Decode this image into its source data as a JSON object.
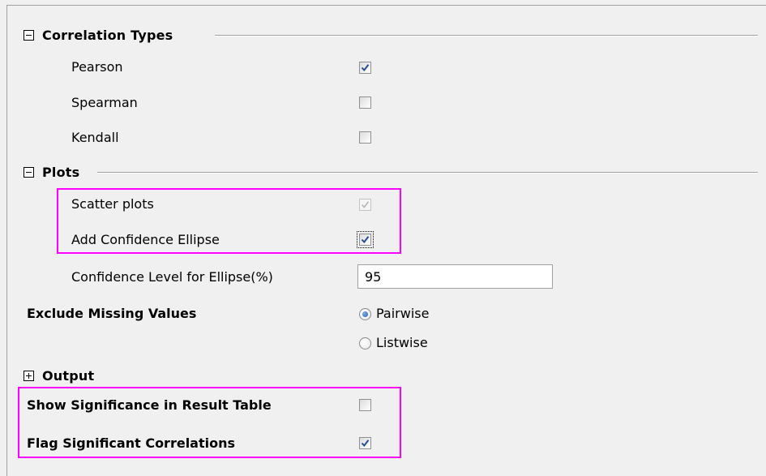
{
  "sections": {
    "correlation_types": {
      "title": "Correlation Types",
      "expanded": true,
      "items": [
        {
          "label": "Pearson",
          "checked": true
        },
        {
          "label": "Spearman",
          "checked": false
        },
        {
          "label": "Kendall",
          "checked": false
        }
      ]
    },
    "plots": {
      "title": "Plots",
      "expanded": true,
      "scatter_label": "Scatter plots",
      "scatter_checked": true,
      "scatter_enabled": false,
      "ellipse_label": "Add Confidence Ellipse",
      "ellipse_checked": true,
      "confidence_label": "Confidence Level for Ellipse(%)",
      "confidence_value": "95"
    },
    "exclude_missing": {
      "label": "Exclude Missing Values",
      "options": [
        "Pairwise",
        "Listwise"
      ],
      "selected": "Pairwise"
    },
    "output": {
      "title": "Output",
      "expanded": false
    },
    "significance": {
      "show_label": "Show Significance in Result Table",
      "show_checked": false,
      "flag_label": "Flag Significant Correlations",
      "flag_checked": true
    }
  },
  "colors": {
    "highlight": "#ff00ff",
    "background": "#f0f0f0",
    "radio_selected": "#1e5fae"
  }
}
